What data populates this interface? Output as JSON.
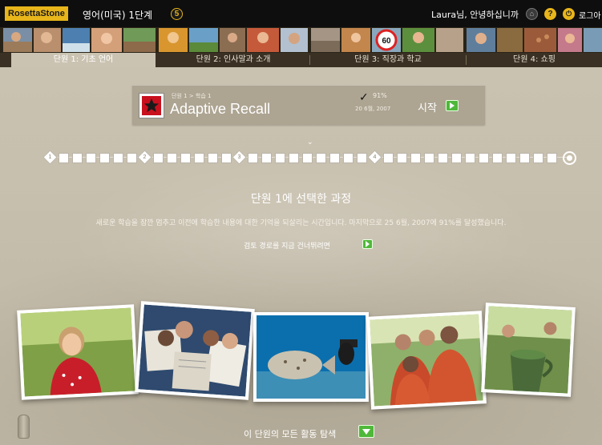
{
  "topbar": {
    "brand": "RosettaStone",
    "course_title": "영어(미국) 1단계",
    "level_badge": "5",
    "greeting": "Laura님, 안녕하십니까",
    "help_icon": "?",
    "logout_label": "로그아"
  },
  "units": [
    {
      "label": "단원 1: 기초 언어"
    },
    {
      "label": "단원 2: 인사말과 소개"
    },
    {
      "label": "단원 3: 직장과 학교"
    },
    {
      "label": "단원 4: 쇼핑"
    }
  ],
  "speed_sign": "60",
  "activity": {
    "breadcrumb": "단원 1 > 학습 1",
    "title": "Adaptive Recall",
    "score": "91%",
    "date": "20 6월, 2007",
    "start_label": "시작"
  },
  "progress": {
    "diamond_labels": [
      "1",
      "2",
      "3",
      "4"
    ],
    "current_fraction": 0.5
  },
  "section": {
    "title": "단원 1에 선택한 과정",
    "description": "새로운 학습을 잠깐 멈추고 이전에 학습한 내용에 대한 기억을 되살리는 시간입니다. 마지막으로 25 6월, 2007에 91%를 달성했습니다.",
    "skip_text": "검토 경로를 지금 건너뛰려면"
  },
  "explore_label": "이 단원의 모든 활동 탐색",
  "colors": {
    "brand_yellow": "#e8b51a",
    "play_green": "#4fb83a"
  }
}
